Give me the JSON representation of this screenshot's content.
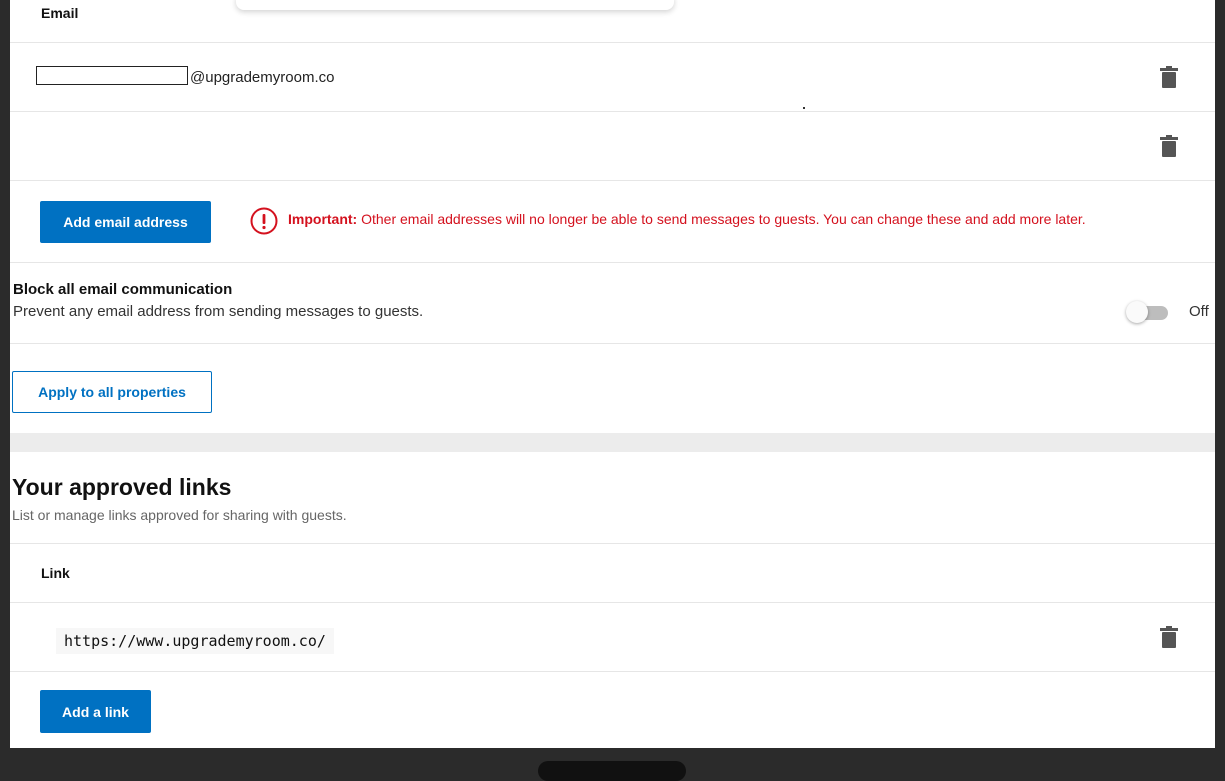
{
  "email_section": {
    "header": "Email",
    "rows": [
      {
        "email_suffix": "@upgrademyroom.co"
      },
      {
        "email_suffix": ""
      }
    ],
    "add_button": "Add email address",
    "warning": {
      "bold": "Important:",
      "text": " Other email addresses will no longer be able to send messages to guests. You can change these and add more later."
    }
  },
  "block_section": {
    "title": "Block all email communication",
    "description": "Prevent any email address from sending messages to guests.",
    "toggle_state": "Off"
  },
  "apply_button": "Apply to all properties",
  "links_section": {
    "title": "Your approved links",
    "description": "List or manage links approved for sharing with guests.",
    "header": "Link",
    "links": [
      "https://www.upgrademyroom.co/"
    ],
    "add_button": "Add a link"
  },
  "colors": {
    "primary": "#0071c2",
    "warning": "#d4111e"
  },
  "icons": {
    "delete": "trash-icon",
    "warning": "exclamation-circle-icon"
  }
}
